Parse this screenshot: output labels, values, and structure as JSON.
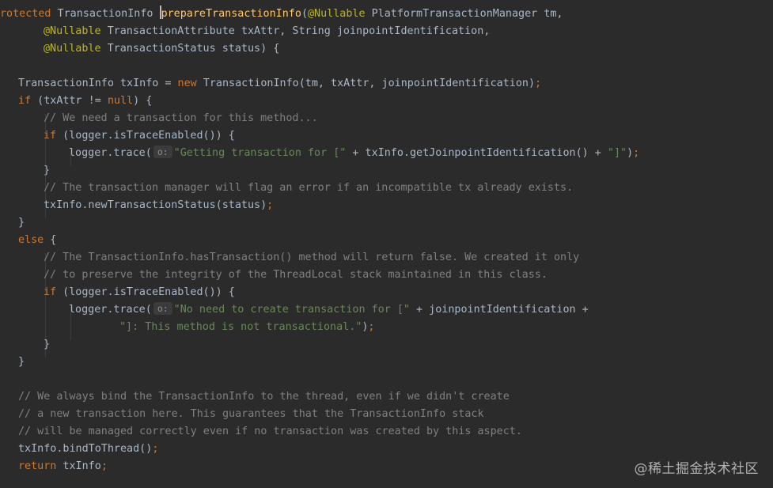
{
  "colors": {
    "background": "#2b2b2b",
    "keyword": "#cc7832",
    "annotation": "#bbb529",
    "method_declaration": "#ffc66d",
    "comment": "#808080",
    "string": "#6a8759",
    "default_text": "#a9b7c6"
  },
  "code": {
    "l1": {
      "kw": "rotected",
      "a": " TransactionInfo ",
      "fn": "prepareTransactionInfo",
      "b": "(",
      "ann": "@Nullable",
      "c": " PlatformTransactionManager tm,"
    },
    "l2": {
      "ann": "@Nullable",
      "a": " TransactionAttribute txAttr, String joinpointIdentification,"
    },
    "l3": {
      "ann": "@Nullable",
      "a": " TransactionStatus status) {"
    },
    "l5": {
      "a": "TransactionInfo txInfo = ",
      "kw": "new",
      "b": " TransactionInfo(tm, txAttr, joinpointIdentification)",
      "kw2": ";"
    },
    "l6": {
      "kw": "if",
      "a": " (txAttr != ",
      "kw2": "null",
      "b": ") {"
    },
    "l7": {
      "cm": "// We need a transaction for this method..."
    },
    "l8": {
      "kw": "if",
      "a": " (logger.isTraceEnabled()) {"
    },
    "l9": {
      "a": "logger.trace(",
      "hint": "o:",
      "str": "\"Getting transaction for [\"",
      "b": " + txInfo.getJoinpointIdentification() + ",
      "str2": "\"]\"",
      "c": ")",
      "kw": ";"
    },
    "l10": {
      "a": "}"
    },
    "l11": {
      "cm": "// The transaction manager will flag an error if an incompatible tx already exists."
    },
    "l12": {
      "a": "txInfo.newTransactionStatus(status)",
      "kw": ";"
    },
    "l13": {
      "a": "}"
    },
    "l14": {
      "kw": "else",
      "a": " {"
    },
    "l15": {
      "cm": "// The TransactionInfo.hasTransaction() method will return false. We created it only"
    },
    "l16": {
      "cm": "// to preserve the integrity of the ThreadLocal stack maintained in this class."
    },
    "l17": {
      "kw": "if",
      "a": " (logger.isTraceEnabled()) {"
    },
    "l18": {
      "a": "logger.trace(",
      "hint": "o:",
      "str": "\"No need to create transaction for [\"",
      "b": " + joinpointIdentification +"
    },
    "l19": {
      "str": "\"]: This method is not transactional.\"",
      "a": ")",
      "kw": ";"
    },
    "l20": {
      "a": "}"
    },
    "l21": {
      "a": "}"
    },
    "l23": {
      "cm": "// We always bind the TransactionInfo to the thread, even if we didn't create"
    },
    "l24": {
      "cm": "// a new transaction here. This guarantees that the TransactionInfo stack"
    },
    "l25": {
      "cm": "// will be managed correctly even if no transaction was created by this aspect."
    },
    "l26": {
      "a": "txInfo.bindToThread()",
      "kw": ";"
    },
    "l27": {
      "kw": "return",
      "a": " txInfo",
      "kw2": ";"
    }
  },
  "watermark": "@稀土掘金技术社区"
}
